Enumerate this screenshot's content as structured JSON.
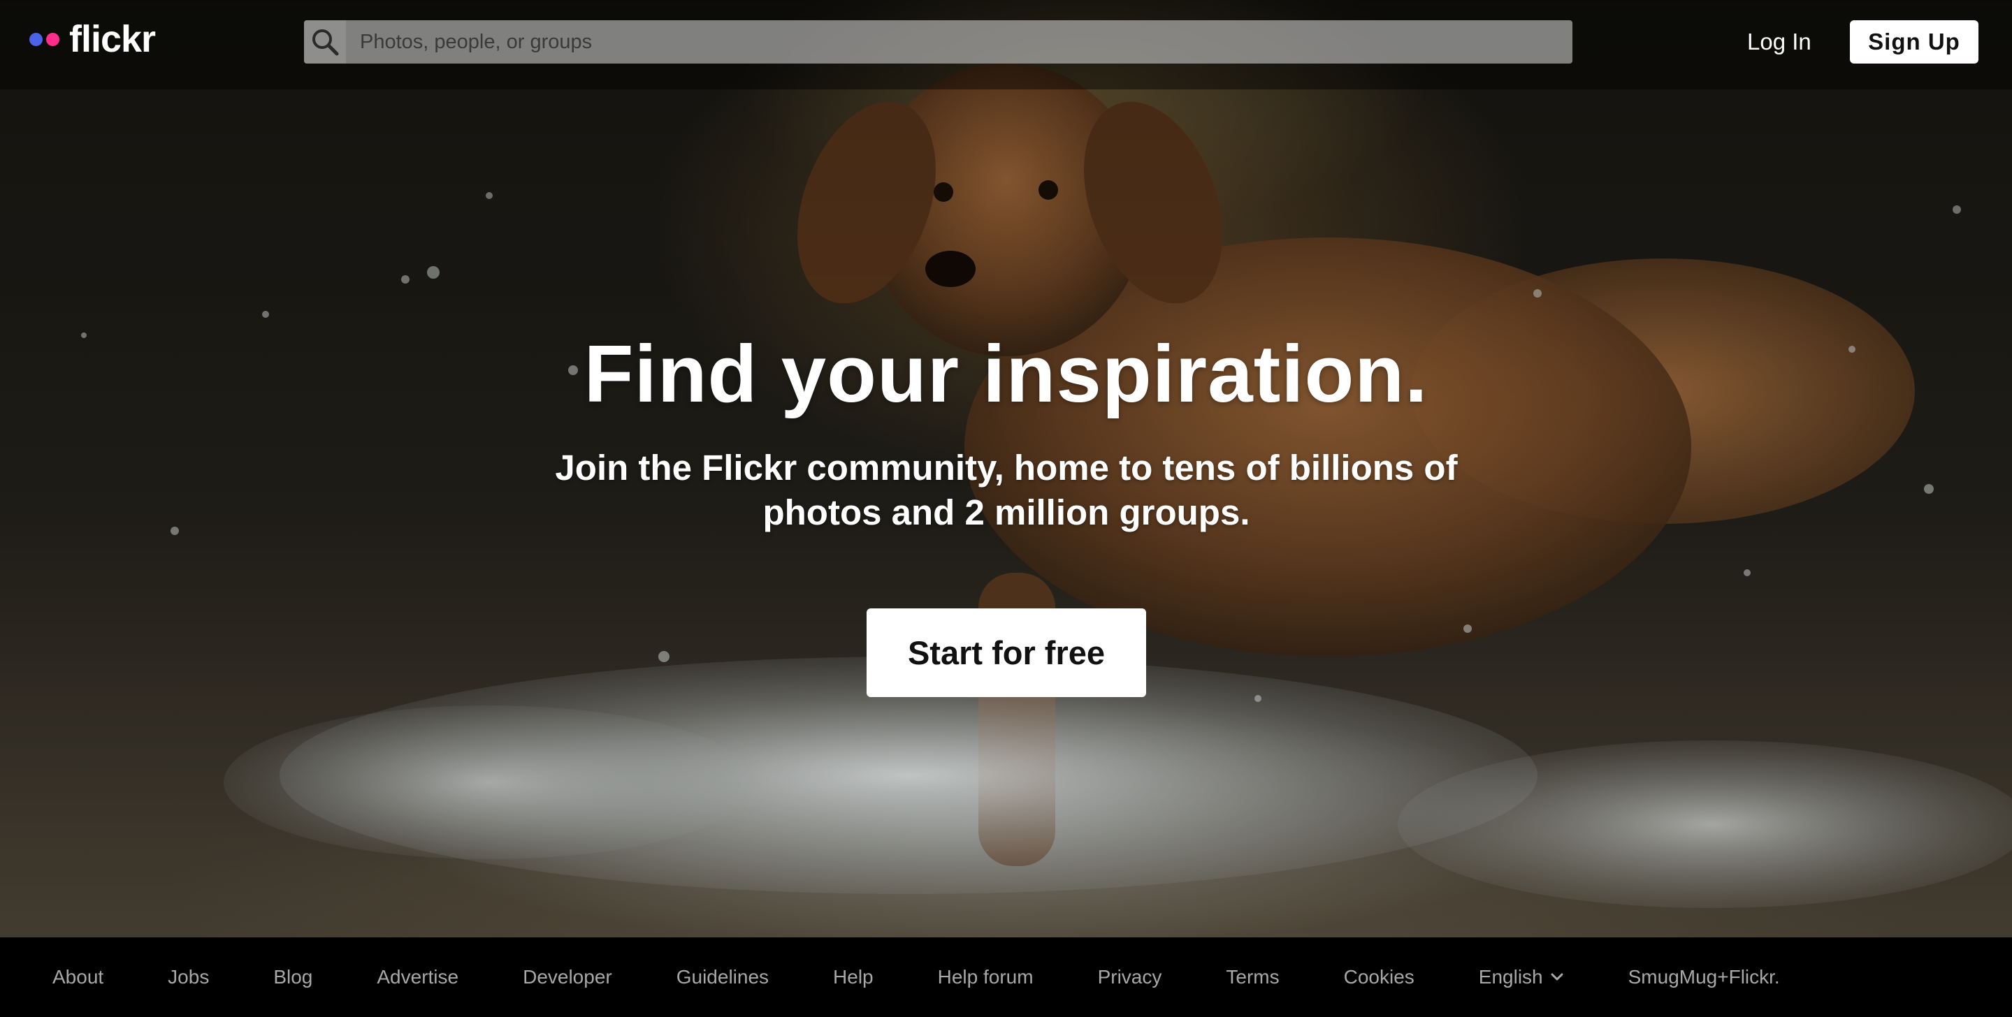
{
  "header": {
    "logo_text": "flickr",
    "logo_dot_colors": [
      "#4a63e8",
      "#ff2d8c"
    ],
    "search": {
      "icon": "search-icon",
      "placeholder": "Photos, people, or groups",
      "value": ""
    },
    "login_label": "Log In",
    "signup_label": "Sign Up"
  },
  "hero": {
    "headline": "Find your inspiration.",
    "subhead": "Join the Flickr community, home to tens of billions of photos and 2 million groups.",
    "cta_label": "Start for free"
  },
  "footer": {
    "links": [
      "About",
      "Jobs",
      "Blog",
      "Advertise",
      "Developer",
      "Guidelines",
      "Help",
      "Help forum",
      "Privacy",
      "Terms",
      "Cookies",
      "English",
      "SmugMug+Flickr."
    ],
    "language_dropdown_icon": "chevron-down-icon"
  },
  "colors": {
    "topbar_bg": "rgba(0,0,0,0.45)",
    "footer_bg": "#000000",
    "footer_text": "#a8a8a8",
    "button_bg": "#ffffff"
  }
}
